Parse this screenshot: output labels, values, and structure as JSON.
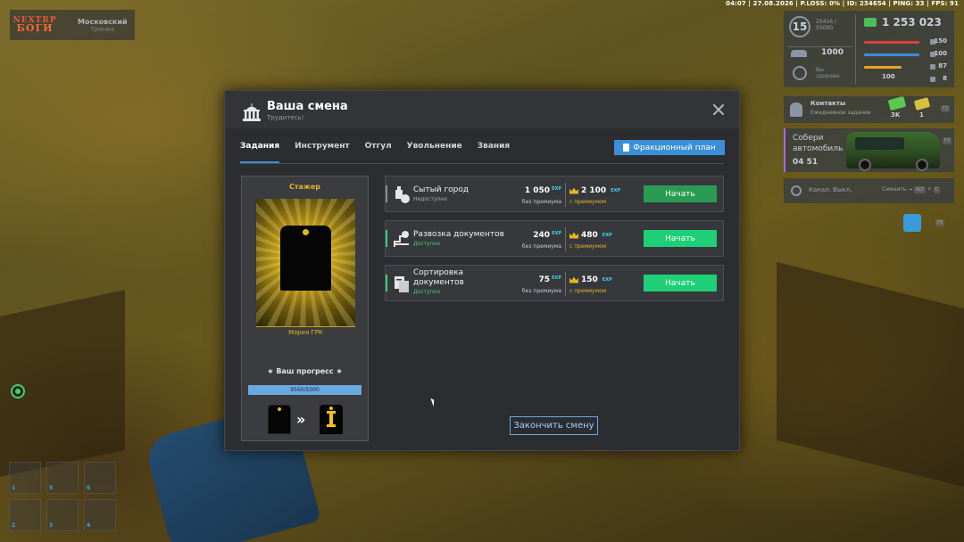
{
  "statusline": "04:07 | 27.08.2026 | P.LOSS: 0% | ID: 234654 | PING: 33 | FPS: 91",
  "logo": {
    "line1": "NEXTRP",
    "line2": "БОГИ"
  },
  "server": {
    "name": "Московский",
    "sub": "Тренка"
  },
  "hud": {
    "level": "15",
    "exp": [
      "25416 /",
      "55000"
    ],
    "money": "1 253 023",
    "cash": "1000",
    "health_label": "Вы здоровы",
    "bars": [
      {
        "value": "150",
        "color": "#d9443a"
      },
      {
        "value": "100",
        "color": "#3a8fd6"
      },
      {
        "value": "87",
        "color": "#e4a81a"
      },
      {
        "value": "8",
        "color": "#8a96a6"
      }
    ],
    "bottom_left": "100"
  },
  "contacts": {
    "title": "Контакты",
    "subtitle": "Ежедневное задание",
    "reward1": "3K",
    "reward2": "1",
    "key": "F2"
  },
  "collect": {
    "text_line1": "Собери",
    "text_line2": "автомобиль",
    "timer": "04 51",
    "key": "F3"
  },
  "radio": {
    "channel": "Канал: Выкл.",
    "switch": "Сменить",
    "key1": "ALT",
    "key2": "C"
  },
  "calendar_key": "F6",
  "hotbar": {
    "slots": [
      "1",
      "5",
      "6",
      "2",
      "3",
      "4"
    ]
  },
  "dialog": {
    "title": "Ваша смена",
    "subtitle": "Трудитесь!",
    "tabs": [
      "Задания",
      "Инструмент",
      "Отгул",
      "Увольнение",
      "Звания"
    ],
    "plan_button": "Фракционный план",
    "rank": {
      "title": "Стажер",
      "plate": "Мэрия ГРК",
      "progress_label": "★ Ваш прогресс ★",
      "progress_text": "9560/5000",
      "progress_fraction": 1.0
    },
    "tasks": [
      {
        "name": "Сытый город",
        "status": "Недоступно",
        "status_color": "#a7acb3",
        "accent": "#8a8d92",
        "exp": "1 050",
        "exp_label": "без премиума",
        "exp_premium": "2 100",
        "premium_label": "с премиумом",
        "button": "Начать",
        "button_color": "#2a9c52",
        "icon": "food-icon"
      },
      {
        "name": "Развозка документов",
        "status": "Доступно",
        "status_color": "#3fd17a",
        "accent": "#3fd17a",
        "exp": "240",
        "exp_label": "без премиума",
        "exp_premium": "480",
        "premium_label": "с премиумом",
        "button": "Начать",
        "button_color": "#1fcf77",
        "icon": "delivery-route-icon"
      },
      {
        "name": "Сортировка документов",
        "status": "Доступно",
        "status_color": "#3fd17a",
        "accent": "#3fd17a",
        "exp": "75",
        "exp_label": "без премиума",
        "exp_premium": "150",
        "premium_label": "с премиумом",
        "button": "Начать",
        "button_color": "#1fcf77",
        "icon": "documents-icon"
      }
    ],
    "exp_tag": "EXP",
    "end_button": "Закончить смену"
  }
}
